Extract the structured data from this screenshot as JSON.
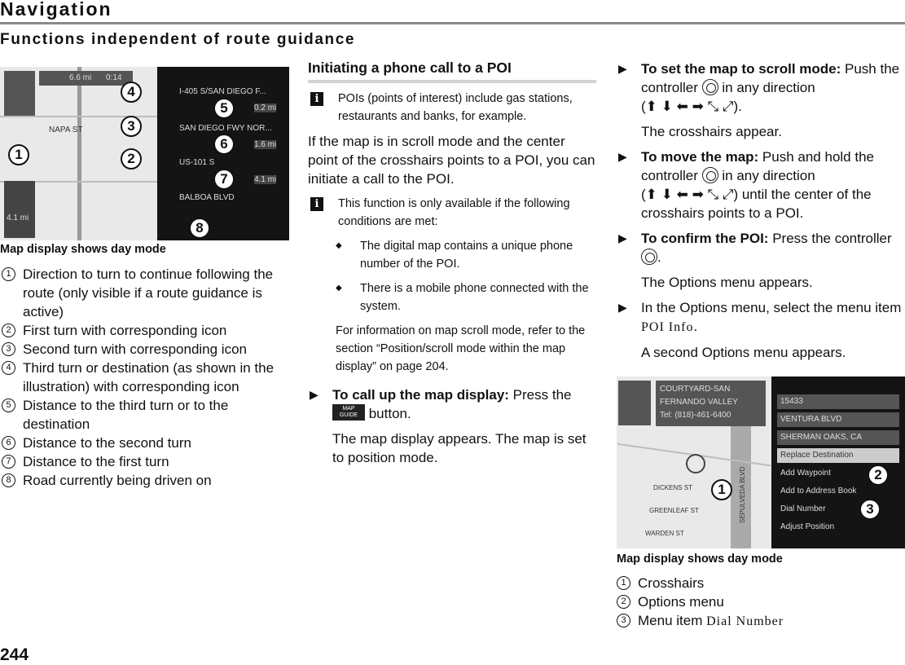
{
  "header": {
    "section": "Navigation",
    "subtitle": "Functions independent of route guidance",
    "page_number": "244"
  },
  "left": {
    "map": {
      "labels": {
        "top_distance": "6.6 mi",
        "top_time": "0:14",
        "street1": "I-405 S/SAN DIEGO F...",
        "street2": "SAN DIEGO FWY NOR...",
        "street3": "US-101 S",
        "street4": "BALBOA BLVD",
        "dist1": "0.2 mi",
        "dist2": "1.6 mi",
        "dist3": "4.1 mi",
        "turn_dist": "4.1 mi",
        "road_napa": "NAPA ST"
      },
      "callouts": [
        "1",
        "2",
        "3",
        "4",
        "5",
        "6",
        "7",
        "8"
      ]
    },
    "caption": "Map display shows day mode",
    "legend": [
      {
        "n": "1",
        "text": "Direction to turn to continue following the route (only visible if a route guidance is active)"
      },
      {
        "n": "2",
        "text": "First turn with corresponding icon"
      },
      {
        "n": "3",
        "text": "Second turn with corresponding icon"
      },
      {
        "n": "4",
        "text": "Third turn or destination (as shown in the illustration) with corresponding icon"
      },
      {
        "n": "5",
        "text": "Distance to the third turn or to the destination"
      },
      {
        "n": "6",
        "text": "Distance to the second turn"
      },
      {
        "n": "7",
        "text": "Distance to the first turn"
      },
      {
        "n": "8",
        "text": "Road currently being driven on"
      }
    ]
  },
  "middle": {
    "heading": "Initiating a phone call to a POI",
    "note1": "POIs (points of interest) include gas stations, restaurants and banks, for example.",
    "para1": "If the map is in scroll mode and the center point of the crosshairs points to a POI, you can initiate a call to the POI.",
    "note2": "This function is only available if the following conditions are met:",
    "bullets": [
      "The digital map contains a unique phone number of the POI.",
      "There is a mobile phone connected with the system."
    ],
    "note3": "For information on map scroll mode, refer to the section “Position/scroll mode within the map display” on page 204.",
    "step1": {
      "bold": "To call up the map display:",
      "pre": " Press the ",
      "button": "MAP GUIDE",
      "post": " button."
    },
    "result1": "The map display appears. The map is set to position mode."
  },
  "right": {
    "step1": {
      "bold": "To set the map to scroll mode:",
      "text1": " Push the controller ",
      "text2": " in any direction",
      "arrows": "(⬆ ⬇ ⬅ ➡ ⤡ ⤢).",
      "result": "The crosshairs appear."
    },
    "step2": {
      "bold": "To move the map:",
      "text1": " Push and hold the controller ",
      "text2": " in any direction",
      "arrows": "(⬆ ⬇ ⬅ ➡ ⤡ ⤢)",
      "text3": " until the center of the crosshairs points to a POI."
    },
    "step3": {
      "bold": "To confirm the POI:",
      "text1": " Press the controller ",
      "text2": ".",
      "result": "The Options menu appears."
    },
    "step4": {
      "text": "In the Options menu, select the menu item ",
      "item": "POI Info",
      "end": ".",
      "result": "A second Options menu appears."
    },
    "map": {
      "poi": [
        "COURTYARD-SAN",
        "FERNANDO VALLEY",
        "Tel: (818)-461-6400"
      ],
      "menu": [
        "15433",
        "VENTURA BLVD",
        "SHERMAN OAKS, CA",
        "Replace Destination",
        "Add Waypoint",
        "Add to Address Book",
        "Dial Number",
        "Adjust Position"
      ],
      "streets": [
        "DICKENS ST",
        "GREENLEAF ST",
        "WARDEN ST",
        "SEPULVEDA BLVD"
      ],
      "callouts": [
        "1",
        "2",
        "3"
      ]
    },
    "caption": "Map display shows day mode",
    "legend": [
      {
        "n": "1",
        "text": "Crosshairs"
      },
      {
        "n": "2",
        "text": "Options menu"
      },
      {
        "n": "3",
        "text": "Menu item ",
        "mono": "Dial Number"
      }
    ]
  }
}
